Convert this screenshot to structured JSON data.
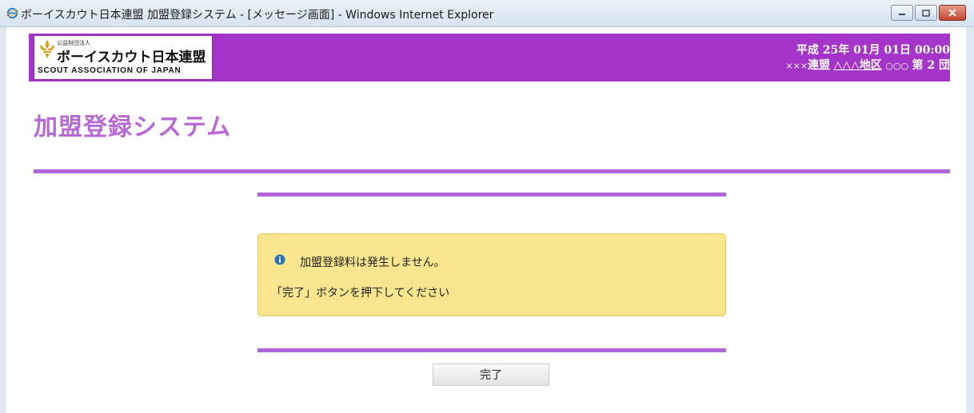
{
  "window": {
    "title": "ボーイスカウト日本連盟 加盟登録システム - [メッセージ画面] - Windows Internet Explorer"
  },
  "header": {
    "logo": {
      "subtitle": "公益財団法人",
      "name": "ボーイスカウト日本連盟",
      "english": "SCOUT ASSOCIATION OF JAPAN"
    },
    "date": "平成 25年 01月 01日 00:00",
    "org": {
      "federation_prefix": "×××",
      "federation_suffix": "連盟",
      "district": "△△△地区",
      "group_prefix": "○○○",
      "group": "第 2 団"
    },
    "background_color": "#a435c8"
  },
  "page": {
    "title": "加盟登録システム",
    "accent_color": "#b165d9"
  },
  "message": {
    "icon": "info-icon",
    "line1": "加盟登録料は発生しません。",
    "line2": "「完了」ボタンを押下してください",
    "background_color": "#f9e58e"
  },
  "actions": {
    "complete_label": "完了"
  }
}
